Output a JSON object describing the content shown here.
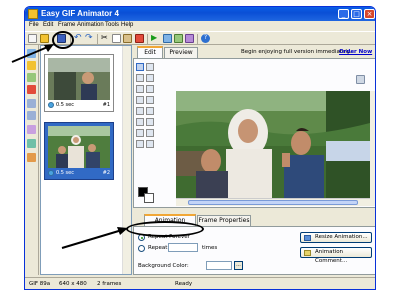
{
  "window": {
    "title": "Easy GIF Animator 4"
  },
  "menu": [
    "File",
    "Edit",
    "Frame",
    "Animation",
    "Tools",
    "Help"
  ],
  "tabs": {
    "edit": "Edit",
    "preview": "Preview"
  },
  "promo": {
    "text": "Begin enjoying full version immediately.",
    "link": "Order Now"
  },
  "frames": [
    {
      "duration": "0.5 sec",
      "number": "#1",
      "selected": false
    },
    {
      "duration": "0.5 sec",
      "number": "#2",
      "selected": true
    }
  ],
  "bottom_tabs": {
    "animation_properties": "Animation Properties",
    "frame_properties": "Frame Properties"
  },
  "properties": {
    "repeat_forever": "Repeat Forever",
    "repeat": "Repeat",
    "repeat_count": "",
    "times": "times",
    "background_color": "Background Color:",
    "browse": "...",
    "resize_button": "Resize Animation...",
    "comment_button": "Animation Comment..."
  },
  "status": {
    "format": "GIF 89a",
    "size": "640 x 480",
    "frames": "2 frames",
    "state": "Ready"
  },
  "colors": {
    "titlebar": "#0a5fe6",
    "selection": "#316ac5",
    "accent_tab": "#f1a736"
  }
}
